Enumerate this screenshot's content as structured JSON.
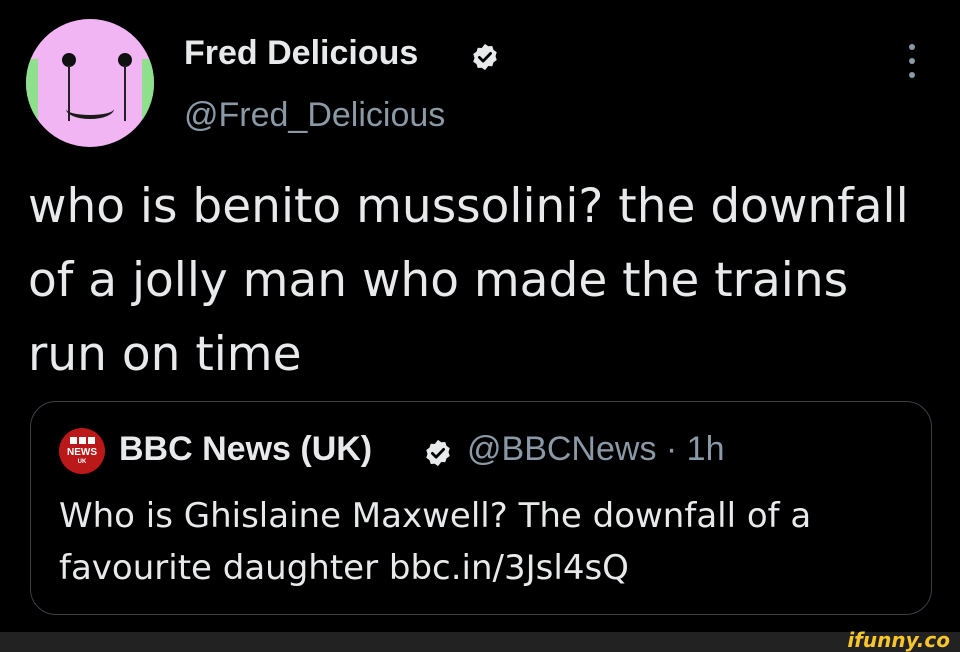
{
  "author": {
    "display_name": "Fred Delicious",
    "handle": "@Fred_Delicious",
    "verified_icon": "verified-badge-icon",
    "avatar_colors": {
      "face": "#f0b5f2",
      "side": "#8fe08c"
    }
  },
  "tweet": {
    "text": "who is benito mussolini? the downfall of a jolly man who made the trains run on time"
  },
  "quoted_tweet": {
    "display_name": "BBC News (UK)",
    "handle_time": "@BBCNews · 1h",
    "text": "Who is Ghislaine Maxwell? The downfall of a favourite daughter bbc.in/3Jsl4sQ",
    "logo": {
      "line1": "NEWS",
      "line2": "UK",
      "color": "#bb1919"
    }
  },
  "watermark": "ifunny.co",
  "colors": {
    "background": "#000000",
    "primary_text": "#e7e9ea",
    "secondary_text": "#8b98a5",
    "border": "#3a3f44",
    "watermark": "#f8c52c"
  }
}
